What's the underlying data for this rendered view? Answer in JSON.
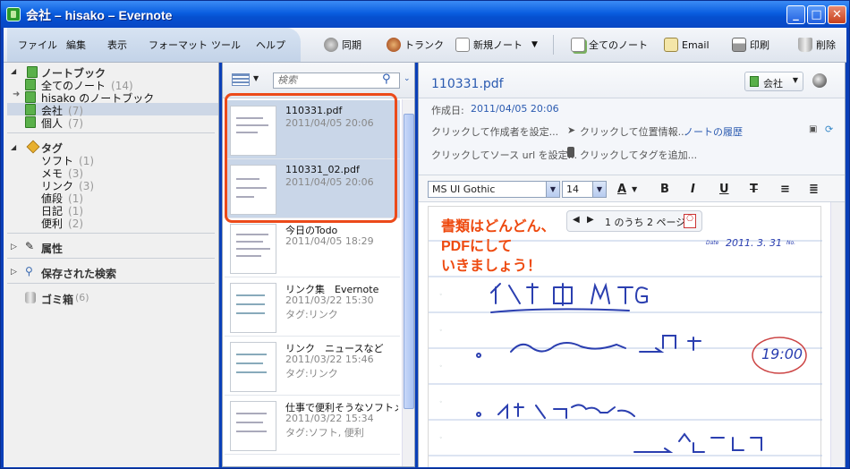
{
  "window": {
    "title": "会社 – hisako – Evernote"
  },
  "menu": [
    "ファイル",
    "編集",
    "表示",
    "フォーマット",
    "ツール",
    "ヘルプ"
  ],
  "toolbar": {
    "sync": "同期",
    "trunk": "トランク",
    "new_note": "新規ノート",
    "all_notes": "全てのノート",
    "email": "Email",
    "print": "印刷",
    "delete": "削除"
  },
  "sidebar": {
    "notebooks_header": "ノートブック",
    "notebooks": [
      {
        "label": "全てのノート",
        "count": "(14)"
      },
      {
        "label": "hisako のノートブック",
        "count": ""
      },
      {
        "label": "会社",
        "count": "(7)"
      },
      {
        "label": "個人",
        "count": "(7)"
      }
    ],
    "tags_header": "タグ",
    "tags": [
      {
        "label": "ソフト",
        "count": "(1)"
      },
      {
        "label": "メモ",
        "count": "(3)"
      },
      {
        "label": "リンク",
        "count": "(3)"
      },
      {
        "label": "値段",
        "count": "(1)"
      },
      {
        "label": "日記",
        "count": "(1)"
      },
      {
        "label": "便利",
        "count": "(2)"
      }
    ],
    "attributes": "属性",
    "saved_searches": "保存された検索",
    "trash": "ゴミ箱",
    "trash_count": "(6)"
  },
  "notelist": {
    "search_placeholder": "検索",
    "notes": [
      {
        "title": "110331.pdf",
        "date": "2011/04/05 20:06",
        "tags": ""
      },
      {
        "title": "110331_02.pdf",
        "date": "2011/04/05 20:06",
        "tags": ""
      },
      {
        "title": "今日のTodo",
        "date": "2011/04/05 18:29",
        "tags": ""
      },
      {
        "title": "リンク集　Evernote",
        "date": "2011/03/22 15:30",
        "tags": "タグ:リンク"
      },
      {
        "title": "リンク　ニュースなど",
        "date": "2011/03/22 15:46",
        "tags": "タグ:リンク"
      },
      {
        "title": "仕事で便利そうなソフトメ...",
        "date": "2011/03/22 15:34",
        "tags": "タグ:ソフト, 便利"
      }
    ]
  },
  "note": {
    "title": "110331.pdf",
    "notebook": "会社",
    "created_label": "作成日:",
    "created": "2011/04/05 20:06",
    "author_hint": "クリックして作成者を設定...",
    "location_hint": "クリックして位置情報...",
    "history": "ノートの履歴",
    "source_hint": "クリックしてソース url を設定...",
    "tag_hint": "クリックしてタグを追加...",
    "font": "MS UI Gothic",
    "size": "14",
    "pager": "1 のうち 2 ページ",
    "annotation": [
      "書類はどんどん、",
      "PDFにして",
      "いきましょう！"
    ]
  },
  "colors": {
    "accent": "#ec4a1a",
    "link": "#2a5ab0",
    "titlebar": "#0a5ee0"
  }
}
